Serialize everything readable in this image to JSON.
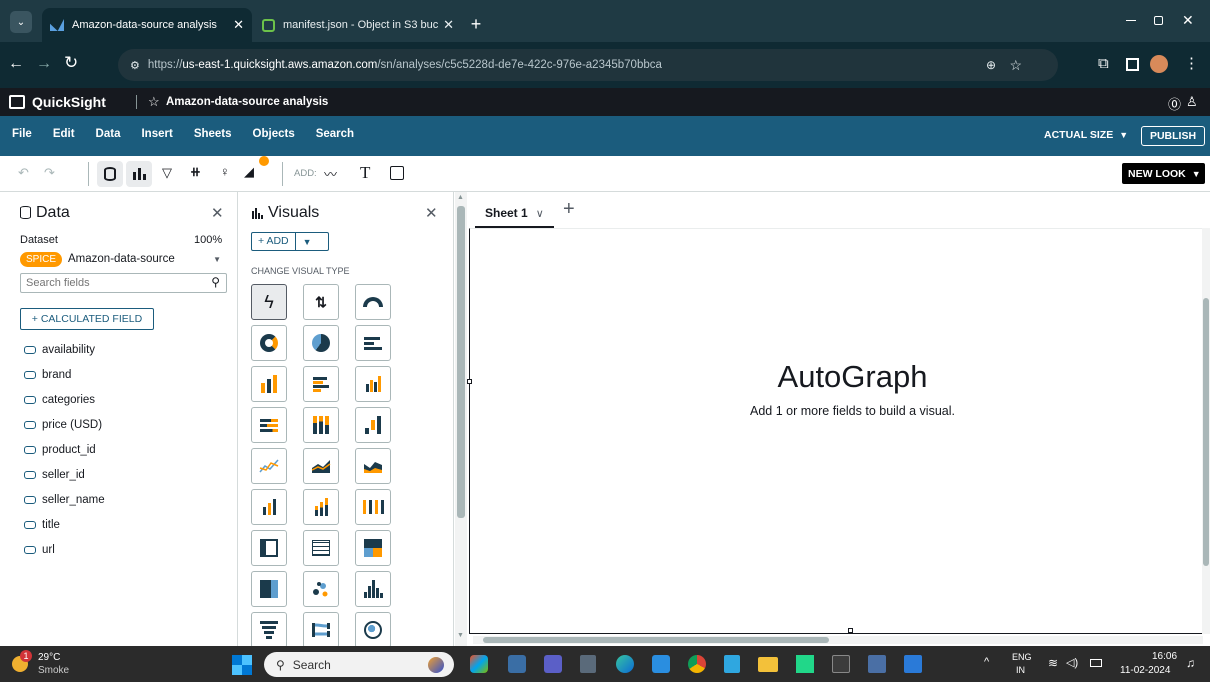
{
  "browser": {
    "tabs": [
      {
        "title": "Amazon-data-source analysis"
      },
      {
        "title": "manifest.json - Object in S3 buc"
      }
    ],
    "url_prefix": "https://",
    "url_host": "us-east-1.quicksight.aws.amazon.com",
    "url_path": "/sn/analyses/c5c5228d-de7e-422c-976e-a2345b70bbca"
  },
  "app": {
    "logo": "QuickSight",
    "analysis_title": "Amazon-data-source analysis"
  },
  "menu": {
    "items": [
      "File",
      "Edit",
      "Data",
      "Insert",
      "Sheets",
      "Objects",
      "Search"
    ],
    "actual_size": "ACTUAL SIZE",
    "publish": "PUBLISH"
  },
  "toolbar": {
    "add_label": "ADD:",
    "new_look": "NEW LOOK"
  },
  "data_panel": {
    "title": "Data",
    "dataset_label": "Dataset",
    "dataset_percent": "100%",
    "spice_badge": "SPICE",
    "dataset_name": "Amazon-data-source",
    "search_placeholder": "Search fields",
    "calc_field": "+ CALCULATED FIELD",
    "fields": [
      "availability",
      "brand",
      "categories",
      "price (USD)",
      "product_id",
      "seller_id",
      "seller_name",
      "title",
      "url"
    ]
  },
  "visuals_panel": {
    "title": "Visuals",
    "add_label": "+ ADD",
    "change_type_label": "CHANGE VISUAL TYPE",
    "icons": [
      "autograph-icon",
      "kpi-icon",
      "gauge-icon",
      "donut-icon",
      "pie-icon",
      "horizontal-bar-icon",
      "vertical-bar-icon",
      "clustered-horizontal-bar-icon",
      "clustered-vertical-bar-icon",
      "stacked-horizontal-bar-icon",
      "stacked-vertical-bar-icon",
      "waterfall-icon",
      "line-icon",
      "area-icon",
      "stacked-area-icon",
      "combo-bar-line-icon",
      "combo-stacked-icon",
      "box-plot-icon",
      "pivot-table-icon",
      "table-icon",
      "heat-map-icon",
      "tree-map-icon",
      "scatter-icon",
      "histogram-icon",
      "funnel-icon",
      "sankey-icon",
      "geo-map-icon"
    ]
  },
  "sheet": {
    "tab_label": "Sheet 1",
    "placeholder_title": "AutoGraph",
    "placeholder_text": "Add 1 or more fields to build a visual."
  },
  "taskbar": {
    "temperature": "29°C",
    "weather": "Smoke",
    "weather_badge": "1",
    "search": "Search",
    "lang_top": "ENG",
    "lang_bottom": "IN",
    "time": "16:06",
    "date": "11-02-2024"
  },
  "colors": {
    "quicksight_blue": "#1b5c7d",
    "spice_orange": "#ff9900",
    "browser_dark": "#0f2a33"
  }
}
